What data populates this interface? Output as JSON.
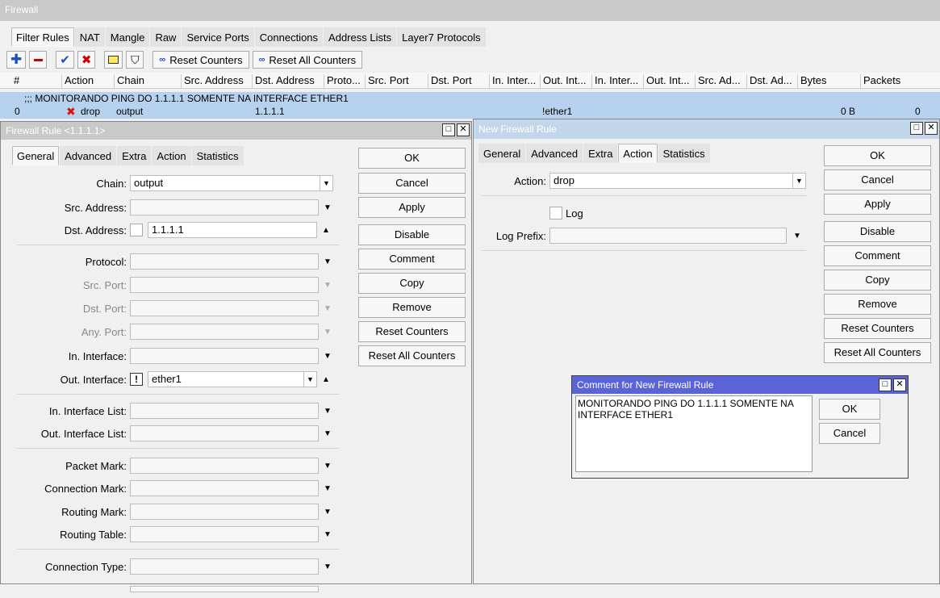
{
  "main": {
    "title": "Firewall",
    "tabs": [
      "Filter Rules",
      "NAT",
      "Mangle",
      "Raw",
      "Service Ports",
      "Connections",
      "Address Lists",
      "Layer7 Protocols"
    ],
    "toolbar": {
      "reset_counters": "Reset Counters",
      "reset_all_counters": "Reset All Counters"
    },
    "columns": [
      "#",
      "Action",
      "Chain",
      "Src. Address",
      "Dst. Address",
      "Proto...",
      "Src. Port",
      "Dst. Port",
      "In. Inter...",
      "Out. Int...",
      "In. Inter...",
      "Out. Int...",
      "Src. Ad...",
      "Dst. Ad...",
      "Bytes",
      "Packets"
    ],
    "comment_row": ";;; MONITORANDO PING DO 1.1.1.1 SOMENTE NA INTERFACE ETHER1",
    "rule_row": {
      "num": "0",
      "action": "drop",
      "chain": "output",
      "dst": "1.1.1.1",
      "out_int": "!ether1",
      "bytes": "0 B",
      "packets": "0"
    }
  },
  "rule_dialog": {
    "title": "Firewall Rule <1.1.1.1>",
    "tabs": [
      "General",
      "Advanced",
      "Extra",
      "Action",
      "Statistics"
    ],
    "fields": {
      "chain_label": "Chain:",
      "chain_value": "output",
      "src_address_label": "Src. Address:",
      "dst_address_label": "Dst. Address:",
      "dst_address_value": "1.1.1.1",
      "protocol_label": "Protocol:",
      "src_port_label": "Src. Port:",
      "dst_port_label": "Dst. Port:",
      "any_port_label": "Any. Port:",
      "in_interface_label": "In. Interface:",
      "out_interface_label": "Out. Interface:",
      "out_interface_value": "ether1",
      "out_interface_negate": "!",
      "in_interface_list_label": "In. Interface List:",
      "out_interface_list_label": "Out. Interface List:",
      "packet_mark_label": "Packet Mark:",
      "connection_mark_label": "Connection Mark:",
      "routing_mark_label": "Routing Mark:",
      "routing_table_label": "Routing Table:",
      "connection_type_label": "Connection Type:"
    },
    "buttons": [
      "OK",
      "Cancel",
      "Apply",
      "Disable",
      "Comment",
      "Copy",
      "Remove",
      "Reset Counters",
      "Reset All Counters"
    ]
  },
  "new_rule_dialog": {
    "title": "New Firewall Rule",
    "tabs": [
      "General",
      "Advanced",
      "Extra",
      "Action",
      "Statistics"
    ],
    "action_label": "Action:",
    "action_value": "drop",
    "log_label": "Log",
    "log_prefix_label": "Log Prefix:",
    "buttons": [
      "OK",
      "Cancel",
      "Apply",
      "Disable",
      "Comment",
      "Copy",
      "Remove",
      "Reset Counters",
      "Reset All Counters"
    ]
  },
  "comment_dialog": {
    "title": "Comment for New Firewall Rule",
    "text": "MONITORANDO PING DO 1.1.1.1 SOMENTE NA INTERFACE ETHER1",
    "ok": "OK",
    "cancel": "Cancel"
  }
}
